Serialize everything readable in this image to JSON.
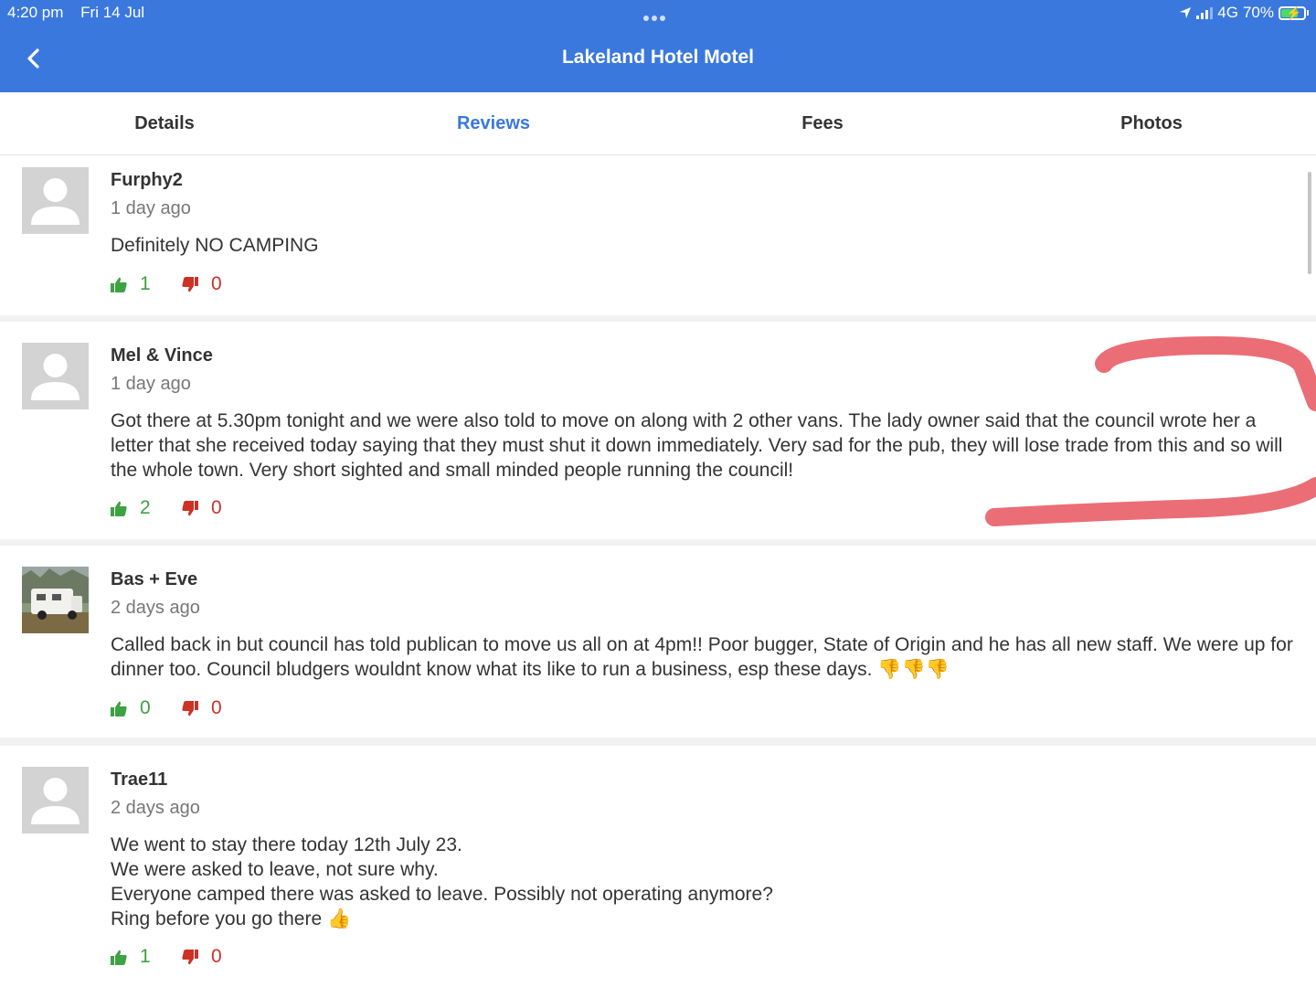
{
  "status": {
    "time": "4:20 pm",
    "date": "Fri 14 Jul",
    "network": "4G",
    "battery": "70%"
  },
  "header": {
    "title": "Lakeland Hotel Motel",
    "back_icon": "chevron-left-icon"
  },
  "tabs": [
    {
      "label": "Details"
    },
    {
      "label": "Reviews",
      "active": true
    },
    {
      "label": "Fees"
    },
    {
      "label": "Photos"
    }
  ],
  "colors": {
    "accent": "#3a78de",
    "upvote": "#3ea142",
    "downvote": "#cc3226",
    "annotation": "#e8545e"
  },
  "reviews": [
    {
      "author": "Furphy2",
      "date": "1 day ago",
      "text": "Definitely NO CAMPING",
      "up": "1",
      "down": "0",
      "avatar": "placeholder-avatar"
    },
    {
      "author": "Mel & Vince",
      "date": "1 day ago",
      "text": "Got there at 5.30pm tonight and we were also told to move on along with 2 other vans. The lady owner said that the council wrote her a letter that she received today saying that they must shut it down immediately. Very sad for the pub, they will lose trade from this and so will the whole town. Very short sighted and small minded people running the council!",
      "up": "2",
      "down": "0",
      "avatar": "placeholder-avatar"
    },
    {
      "author": "Bas + Eve",
      "date": "2 days ago",
      "text": "Called back in but council has told publican to move us all on at 4pm!! Poor bugger, State of Origin and he has all new staff. We were up for dinner too. Council bludgers wouldnt know what its like to run a business, esp these days. 👎👎👎",
      "up": "0",
      "down": "0",
      "avatar": "campervan-photo"
    },
    {
      "author": "Trae11",
      "date": "2 days ago",
      "text": "We went to stay there today 12th July 23.\nWe were asked to leave, not sure why.\nEveryone camped there was asked to leave. Possibly not operating anymore?\nRing before you go there 👍",
      "up": "1",
      "down": "0",
      "avatar": "placeholder-avatar"
    }
  ]
}
